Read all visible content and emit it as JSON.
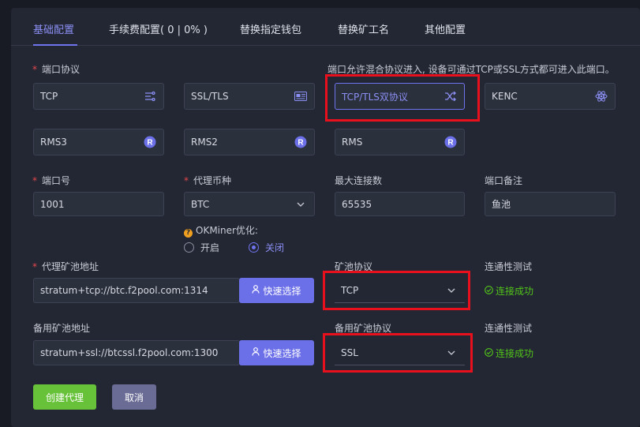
{
  "tabs": [
    "基础配置",
    "手续费配置( 0 | 0% )",
    "替换指定钱包",
    "替换矿工名",
    "其他配置"
  ],
  "port_protocol": {
    "label": "端口协议",
    "hint": "端口允许混合协议进入, 设备可通过TCP或SSL方式都可进入此端口。",
    "options": [
      "TCP",
      "SSL/TLS",
      "TCP/TLS双协议",
      "KENC",
      "RMS3",
      "RMS2",
      "RMS"
    ],
    "selected": "TCP/TLS双协议"
  },
  "port_number": {
    "label": "端口号",
    "value": "1001"
  },
  "proxy_coin": {
    "label": "代理币种",
    "value": "BTC"
  },
  "max_connections": {
    "label": "最大连接数",
    "value": "65535"
  },
  "port_note": {
    "label": "端口备注",
    "value": "鱼池"
  },
  "okminer": {
    "label": "OKMiner优化:",
    "options": [
      "开启",
      "关闭"
    ],
    "selected": "关闭"
  },
  "pool_address": {
    "label": "代理矿池地址",
    "value": "stratum+tcp://btc.f2pool.com:1314",
    "button": "快速选择"
  },
  "pool_protocol": {
    "label": "矿池协议",
    "value": "TCP"
  },
  "connectivity": {
    "label": "连通性测试",
    "status": "连接成功"
  },
  "backup_pool_address": {
    "label": "备用矿池地址",
    "value": "stratum+ssl://btcssl.f2pool.com:1300",
    "button": "快速选择"
  },
  "backup_pool_protocol": {
    "label": "备用矿池协议",
    "value": "SSL"
  },
  "backup_connectivity": {
    "label": "连通性测试",
    "status": "连接成功"
  },
  "actions": {
    "create": "创建代理",
    "cancel": "取消"
  },
  "colors": {
    "accent": "#6f73ee",
    "primary_green": "#67c23a",
    "success": "#52c41a",
    "highlight_box": "#e8101c"
  }
}
